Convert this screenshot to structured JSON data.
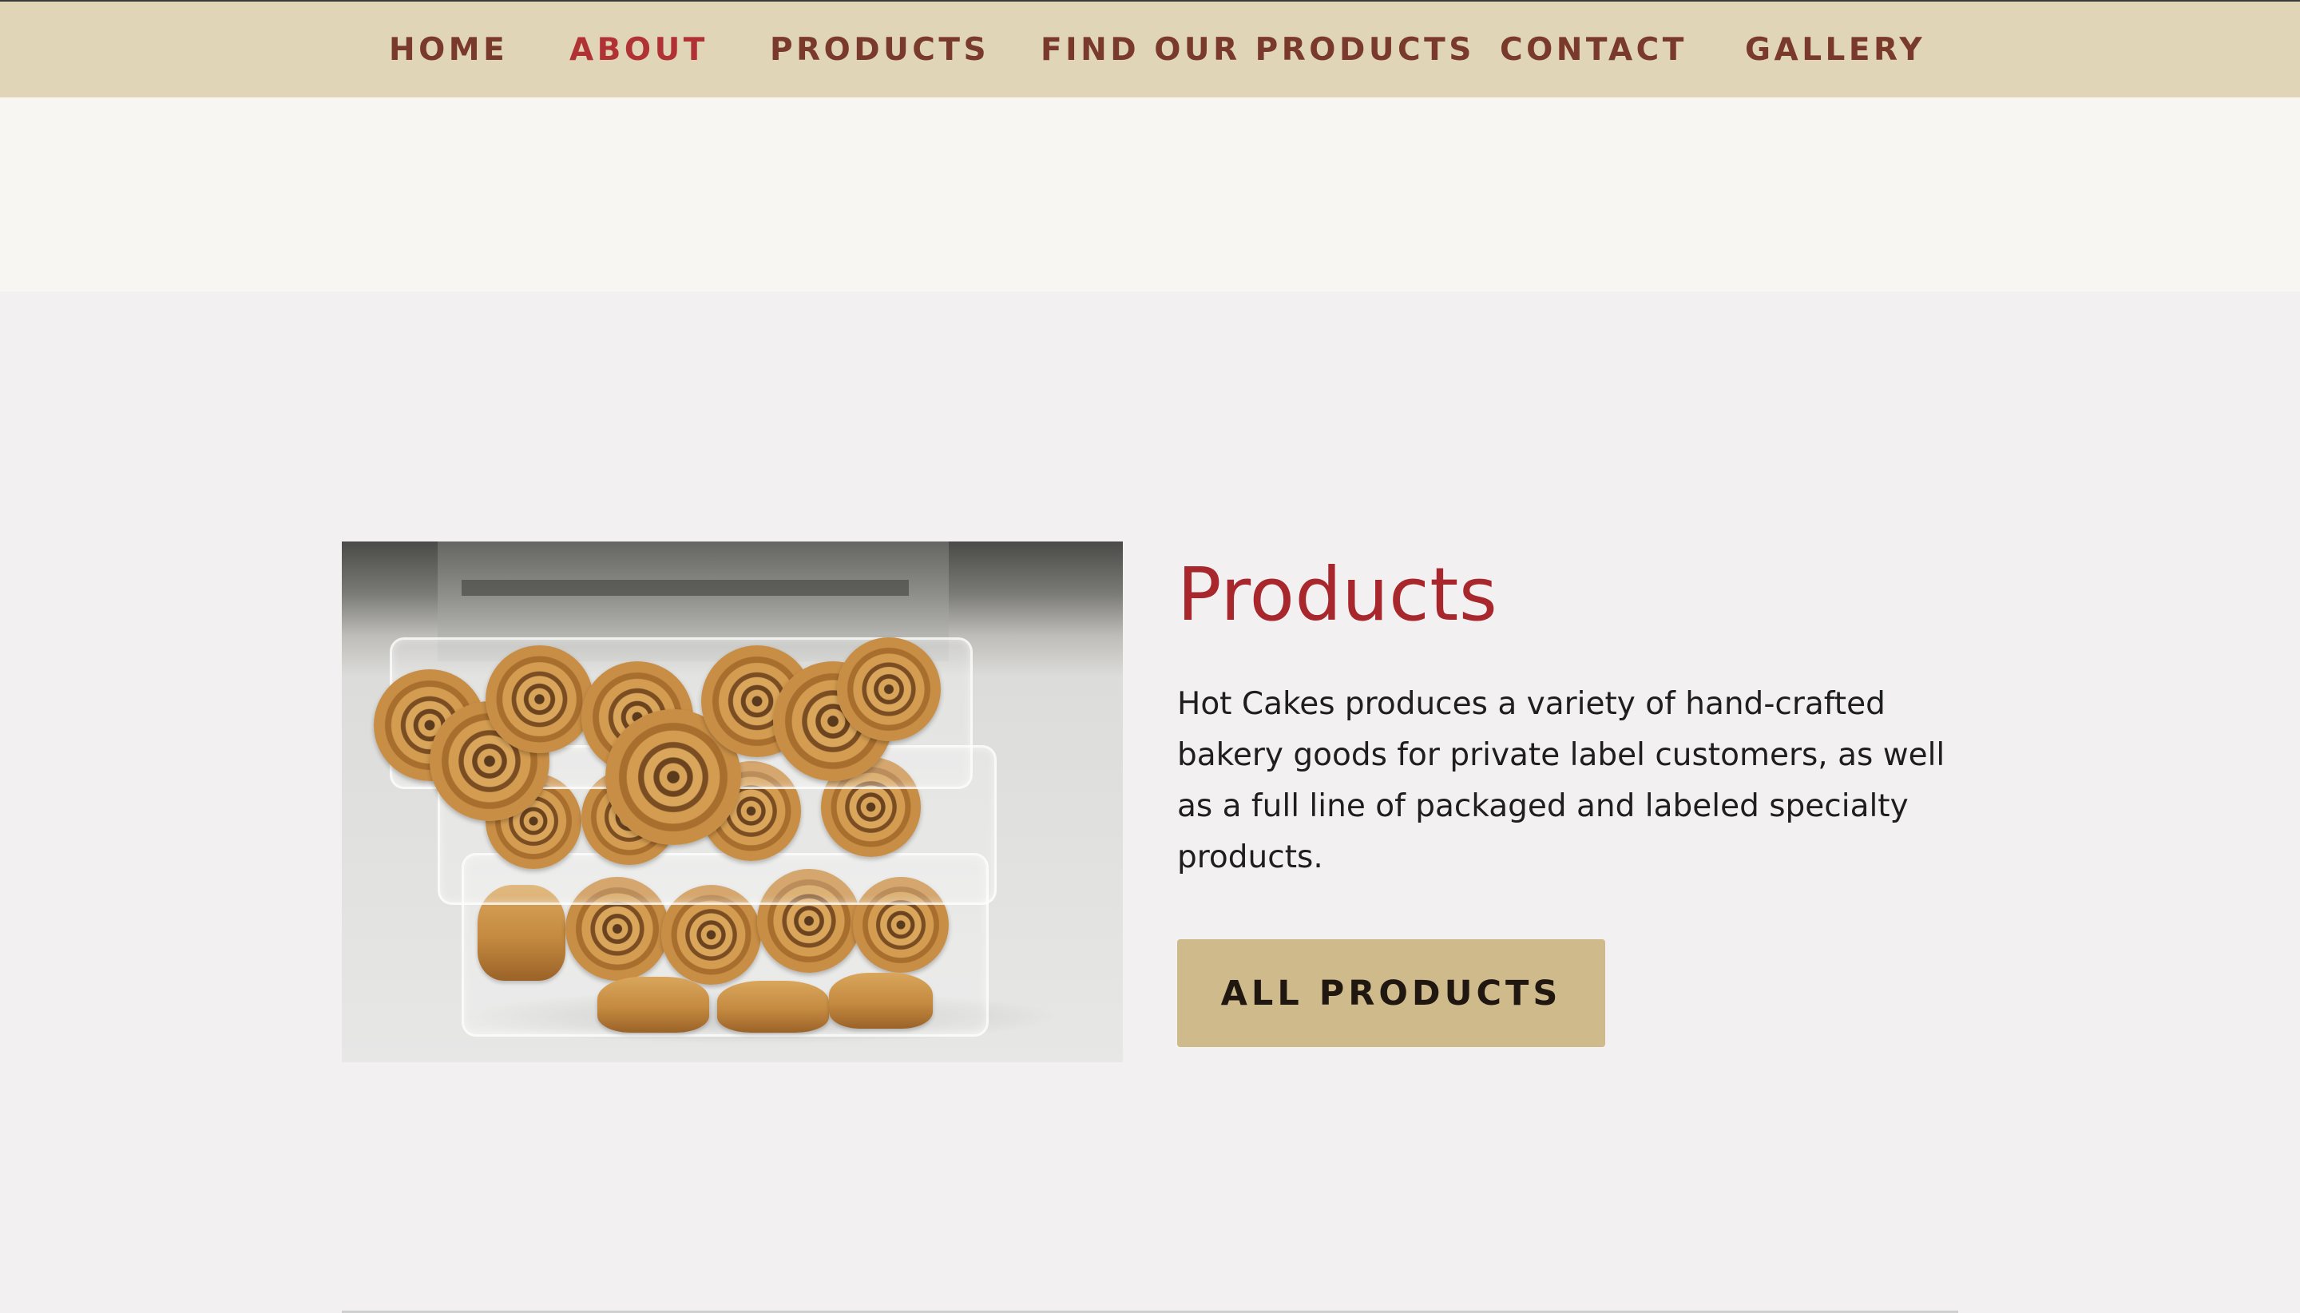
{
  "nav": {
    "items": [
      {
        "label": "HOME"
      },
      {
        "label": "ABOUT"
      },
      {
        "label": "PRODUCTS"
      },
      {
        "label": "FIND OUR PRODUCTS"
      },
      {
        "label": "CONTACT"
      },
      {
        "label": "GALLERY"
      }
    ],
    "active_index": 1
  },
  "section": {
    "title": "Products",
    "description": "Hot Cakes produces a variety of hand-crafted bakery goods for private label customers, as well as a full line of packaged and labeled specialty products.",
    "button_label": "ALL PRODUCTS"
  },
  "colors": {
    "nav_bg": "#e0d5b6",
    "nav_text": "#7a3a2b",
    "nav_active": "#b03235",
    "title": "#a8272c",
    "button_bg": "#cfba8c",
    "page_bg": "#f2f0f1"
  }
}
